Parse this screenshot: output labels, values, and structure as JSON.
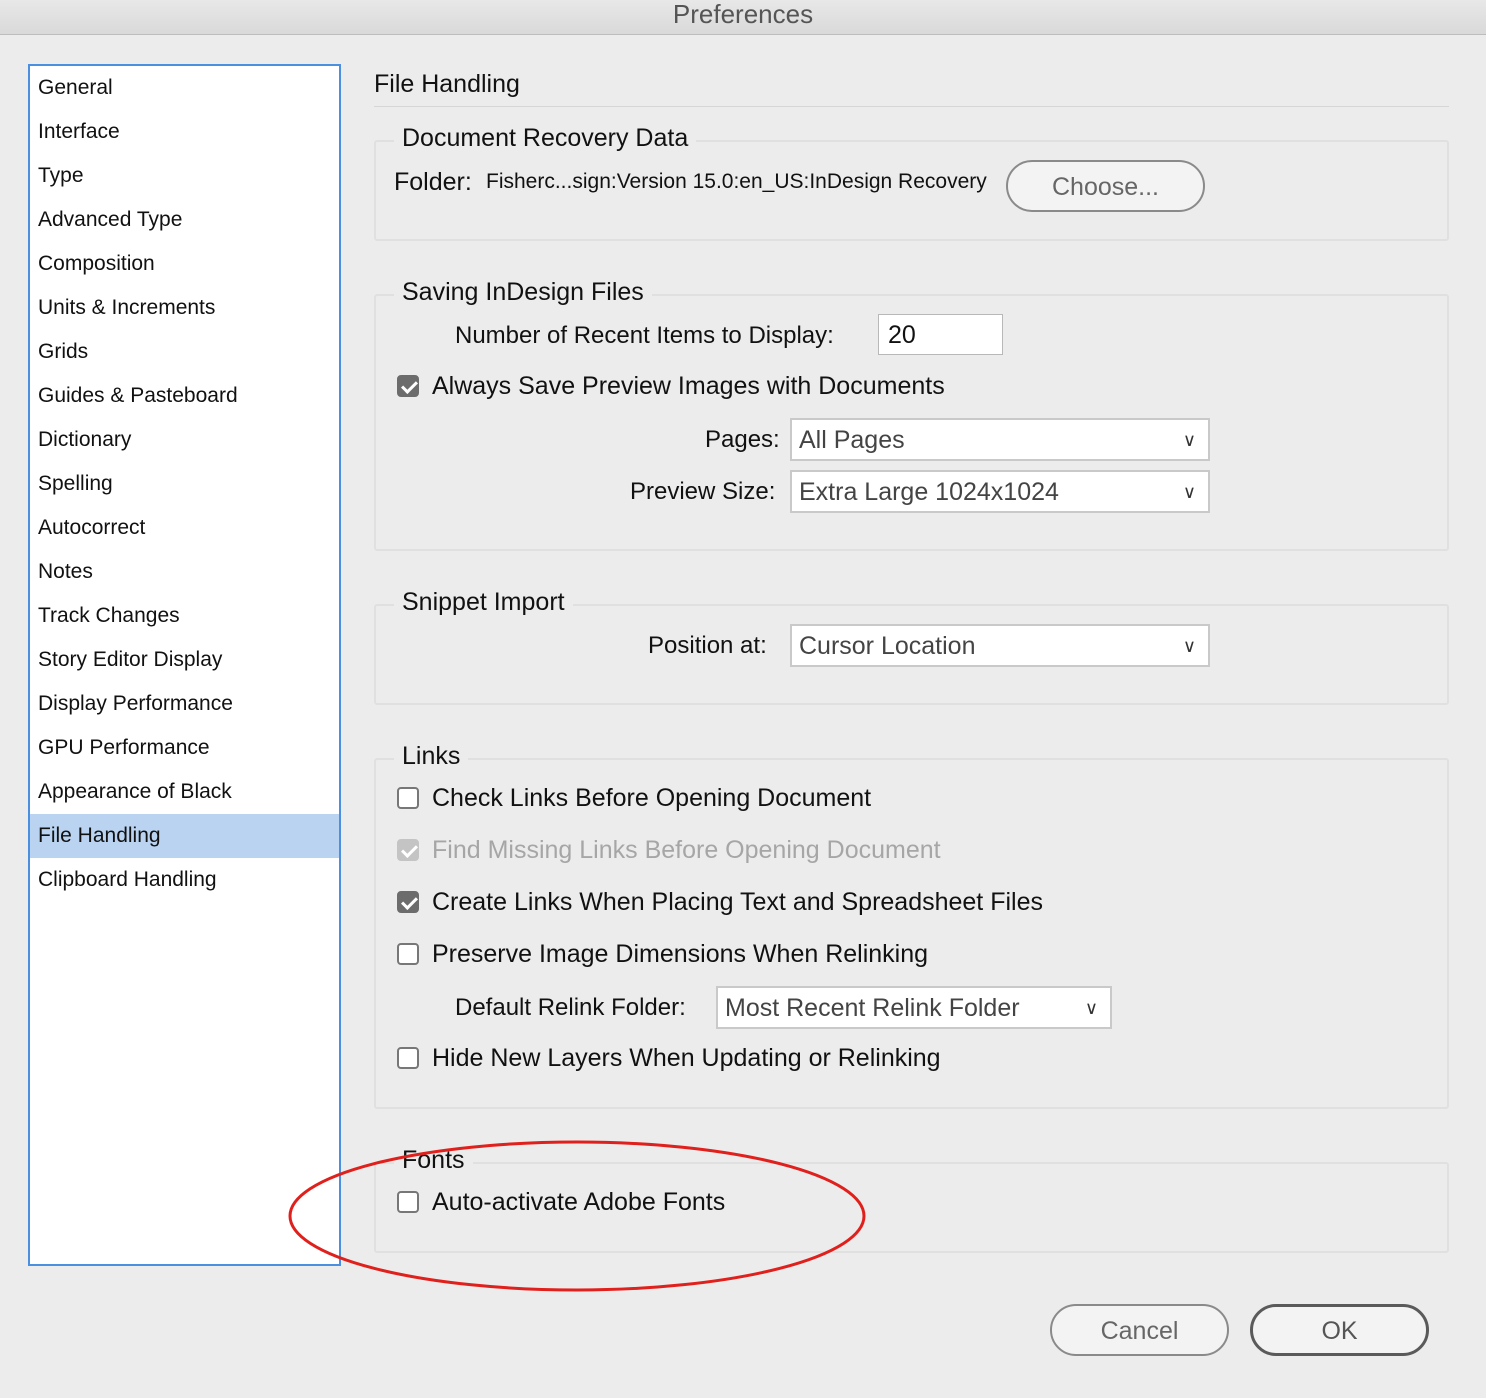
{
  "window": {
    "title": "Preferences"
  },
  "sidebar": {
    "items": [
      {
        "label": "General"
      },
      {
        "label": "Interface"
      },
      {
        "label": "Type"
      },
      {
        "label": "Advanced Type"
      },
      {
        "label": "Composition"
      },
      {
        "label": "Units & Increments"
      },
      {
        "label": "Grids"
      },
      {
        "label": "Guides & Pasteboard"
      },
      {
        "label": "Dictionary"
      },
      {
        "label": "Spelling"
      },
      {
        "label": "Autocorrect"
      },
      {
        "label": "Notes"
      },
      {
        "label": "Track Changes"
      },
      {
        "label": "Story Editor Display"
      },
      {
        "label": "Display Performance"
      },
      {
        "label": "GPU Performance"
      },
      {
        "label": "Appearance of Black"
      },
      {
        "label": "File Handling",
        "selected": true
      },
      {
        "label": "Clipboard Handling"
      }
    ]
  },
  "page": {
    "title": "File Handling"
  },
  "recovery": {
    "legend": "Document Recovery Data",
    "folder_label": "Folder:",
    "folder_path": "Fisherc...sign:Version 15.0:en_US:InDesign Recovery",
    "choose_label": "Choose..."
  },
  "saving": {
    "legend": "Saving InDesign Files",
    "recent_label": "Number of Recent Items to Display:",
    "recent_value": "20",
    "preview_checkbox": {
      "label": "Always Save Preview Images with Documents",
      "checked": true
    },
    "pages_label": "Pages:",
    "pages_value": "All Pages",
    "preview_size_label": "Preview Size:",
    "preview_size_value": "Extra Large 1024x1024"
  },
  "snippet": {
    "legend": "Snippet Import",
    "position_label": "Position at:",
    "position_value": "Cursor Location"
  },
  "links": {
    "legend": "Links",
    "check_links": {
      "label": "Check Links Before Opening Document",
      "checked": false
    },
    "find_missing": {
      "label": "Find Missing Links Before Opening Document",
      "checked": true,
      "disabled": true
    },
    "create_links": {
      "label": "Create Links When Placing Text and Spreadsheet Files",
      "checked": true
    },
    "preserve_dims": {
      "label": "Preserve Image Dimensions When Relinking",
      "checked": false
    },
    "relink_folder_label": "Default Relink Folder:",
    "relink_folder_value": "Most Recent Relink Folder",
    "hide_layers": {
      "label": "Hide New Layers When Updating or Relinking",
      "checked": false
    }
  },
  "fonts": {
    "legend": "Fonts",
    "auto_activate": {
      "label": "Auto-activate Adobe Fonts",
      "checked": false
    }
  },
  "buttons": {
    "cancel": "Cancel",
    "ok": "OK"
  },
  "colors": {
    "selection": "#b9d3f0",
    "sidebar_border": "#4a8fe0",
    "annotation": "#e0201c"
  },
  "icons": {
    "dropdown": "chevron-down-icon",
    "check": "checkmark-icon"
  }
}
